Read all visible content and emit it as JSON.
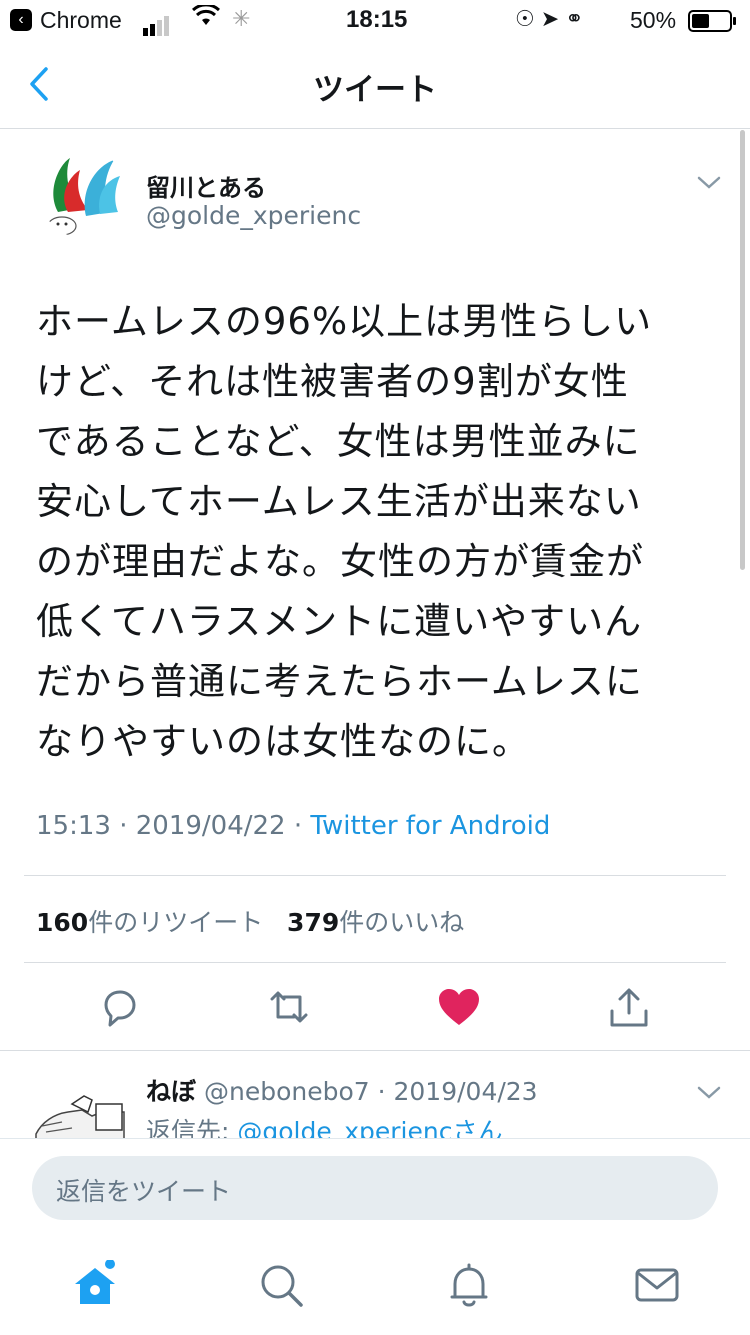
{
  "status_bar": {
    "back_app": "Chrome",
    "time": "18:15",
    "battery": "50%"
  },
  "nav": {
    "title": "ツイート"
  },
  "tweet": {
    "author_name": "留川とある",
    "author_handle": "@golde_xperienc",
    "lines": [
      "ホームレスの96%以上は男性らしい",
      "けど、それは性被害者の9割が女性",
      "であることなど、女性は男性並みに",
      "安心してホームレス生活が出来ない",
      "のが理由だよな。女性の方が賃金が",
      "低くてハラスメントに遭いやすいん",
      "だから普通に考えたらホームレスに",
      "なりやすいのは女性なのに。"
    ],
    "time": "15:13",
    "date": "2019/04/22",
    "source": "Twitter for Android",
    "retweet_count": "160",
    "retweet_label": "件のリツイート",
    "like_count": "379",
    "like_label": "件のいいね",
    "liked": true,
    "like_color": "#e0245e"
  },
  "reply": {
    "name": "ねぼ",
    "handle": "@nebonebo7",
    "date": "2019/04/23",
    "reply_prefix": "返信先: ",
    "reply_mention": "@golde_xperienc",
    "reply_suffix": "さん"
  },
  "compose": {
    "placeholder": "返信をツイート"
  },
  "colors": {
    "accent": "#1da1f2",
    "muted": "#657786"
  },
  "tabs": [
    "home-icon",
    "search-icon",
    "notifications-icon",
    "messages-icon"
  ]
}
